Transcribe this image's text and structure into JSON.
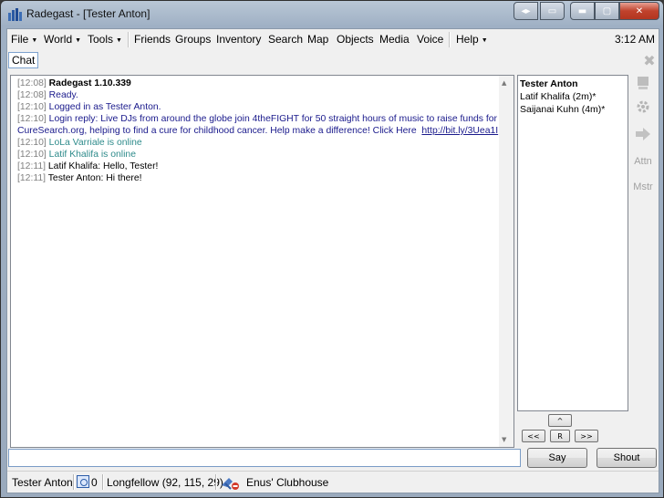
{
  "window": {
    "title": "Radegast - [Tester Anton]",
    "caption_buttons": {
      "ext1": "◂▸",
      "ext2": "▭",
      "min": "▬",
      "max": "▢",
      "close": "✕"
    }
  },
  "menu": {
    "items": [
      "File",
      "World",
      "Tools",
      "Friends",
      "Groups",
      "Inventory",
      "Search",
      "Map",
      "Objects",
      "Media",
      "Voice",
      "Help"
    ],
    "clock": "3:12 AM"
  },
  "tabs": {
    "active": "Chat"
  },
  "chat_log": [
    {
      "ts": "[12:08]",
      "text": "Radegast 1.10.339",
      "style": "bold"
    },
    {
      "ts": "[12:08]",
      "text": "Ready.",
      "style": "sys"
    },
    {
      "ts": "[12:10]",
      "text": "Logged in as Tester Anton.",
      "style": "sys"
    },
    {
      "ts": "[12:10]",
      "text": "Login reply: Live DJs from around the globe join 4theFIGHT for 50 straight hours of music to raise funds for",
      "style": "sys"
    },
    {
      "ts": "",
      "text": "CureSearch.org, helping to find a cure for childhood cancer.  Help make a difference!  Click Here",
      "link": "http://bit.ly/3Uea1I",
      "style": "sys"
    },
    {
      "ts": "[12:10]",
      "text": "LoLa Varriale is online",
      "style": "online"
    },
    {
      "ts": "[12:10]",
      "text": "Latif Khalifa is online",
      "style": "online"
    },
    {
      "ts": "[12:11]",
      "text": "Latif Khalifa: Hello, Tester!",
      "style": "msg"
    },
    {
      "ts": "[12:11]",
      "text": "Tester Anton: Hi there!",
      "style": "msg"
    }
  ],
  "people": {
    "self": "Tester Anton",
    "list": [
      "Latif Khalifa (2m)*",
      "Saijanai Kuhn (4m)*"
    ]
  },
  "side_tools": {
    "attn": "Attn",
    "mstr": "Mstr"
  },
  "nav": {
    "up": "^",
    "left": "<<",
    "reset": "R",
    "right": ">>"
  },
  "input": {
    "value": "",
    "say": "Say",
    "shout": "Shout"
  },
  "status": {
    "name": "Tester Anton",
    "balance": "0",
    "location": "Longfellow (92, 115, 29)",
    "parcel": "Enus' Clubhouse"
  }
}
